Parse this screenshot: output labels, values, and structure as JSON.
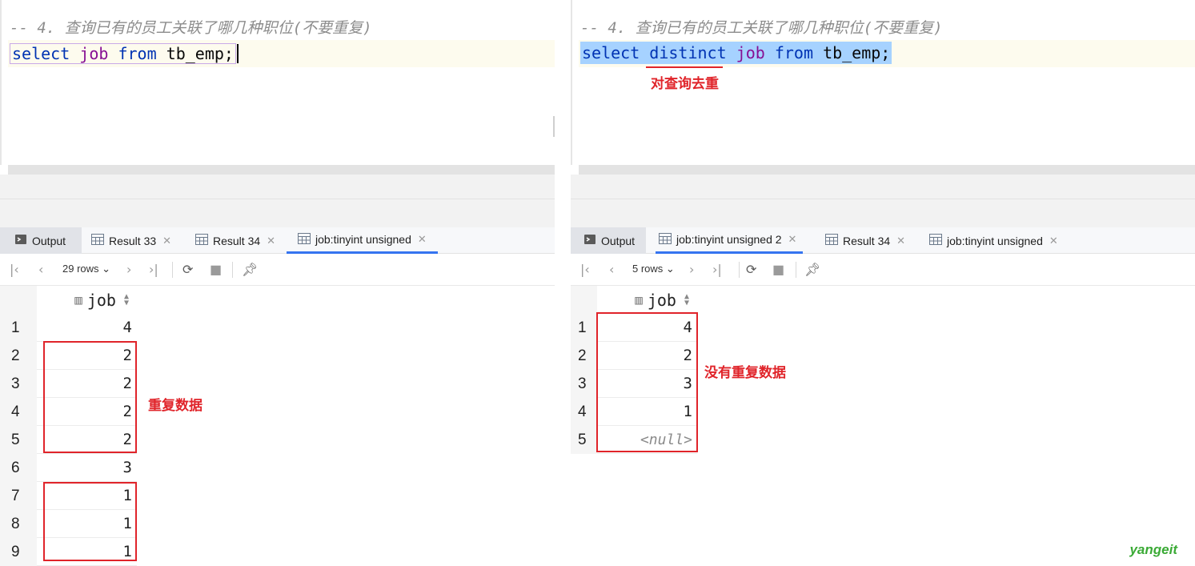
{
  "left": {
    "comment": "-- 4. 查询已有的员工关联了哪几种职位(不要重复)",
    "sql": {
      "kw1": "select",
      "col": "job",
      "kw2": "from",
      "table": "tb_emp;"
    },
    "tabs": [
      {
        "label": "Output"
      },
      {
        "label": "Result 33"
      },
      {
        "label": "Result 34"
      },
      {
        "label": "job:tinyint unsigned"
      }
    ],
    "rows_label": "29 rows",
    "column_header": "job",
    "rows": [
      {
        "n": "1",
        "v": "4"
      },
      {
        "n": "2",
        "v": "2"
      },
      {
        "n": "3",
        "v": "2"
      },
      {
        "n": "4",
        "v": "2"
      },
      {
        "n": "5",
        "v": "2"
      },
      {
        "n": "6",
        "v": "3"
      },
      {
        "n": "7",
        "v": "1"
      },
      {
        "n": "8",
        "v": "1"
      },
      {
        "n": "9",
        "v": "1"
      }
    ],
    "annotation": "重复数据"
  },
  "right": {
    "comment": "-- 4. 查询已有的员工关联了哪几种职位(不要重复)",
    "sql": {
      "kw1": "select",
      "kw_distinct": "distinct",
      "col": "job",
      "kw2": "from",
      "table": "tb_emp;"
    },
    "annotation_top": "对查询去重",
    "tabs": [
      {
        "label": "Output"
      },
      {
        "label": "job:tinyint unsigned 2"
      },
      {
        "label": "Result 34"
      },
      {
        "label": "job:tinyint unsigned"
      }
    ],
    "rows_label": "5 rows",
    "column_header": "job",
    "rows": [
      {
        "n": "1",
        "v": "4"
      },
      {
        "n": "2",
        "v": "2"
      },
      {
        "n": "3",
        "v": "3"
      },
      {
        "n": "4",
        "v": "1"
      },
      {
        "n": "5",
        "v": "<null>"
      }
    ],
    "annotation": "没有重复数据"
  },
  "watermark": "yangeit",
  "colors": {
    "accent": "#3574f0",
    "annotation": "#e0242a",
    "keyword": "#0033b3",
    "identifier": "#871094"
  }
}
